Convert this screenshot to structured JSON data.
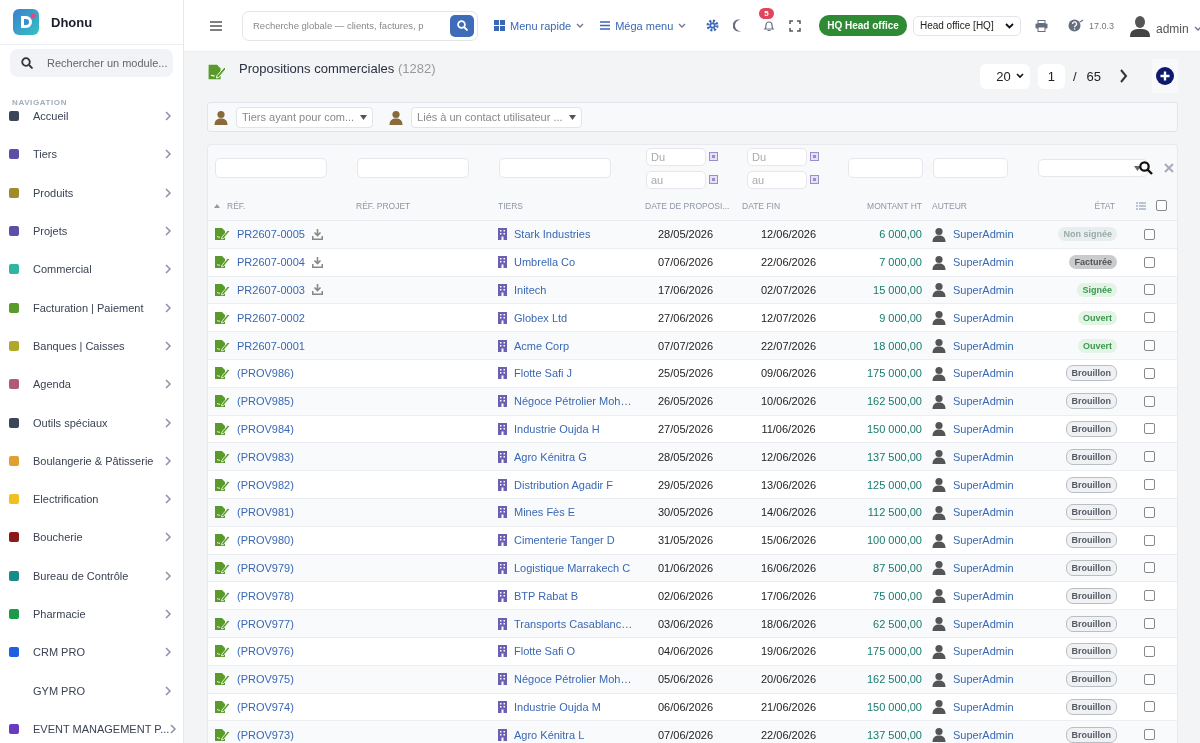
{
  "brand": {
    "name": "Dhonu"
  },
  "sidebar": {
    "search_placeholder": "Rechercher un module...",
    "section": "NAVIGATION",
    "items": [
      {
        "label": "Accueil",
        "color": "#3d4657"
      },
      {
        "label": "Tiers",
        "color": "#5b4fa8"
      },
      {
        "label": "Produits",
        "color": "#a08a2a"
      },
      {
        "label": "Projets",
        "color": "#5b4fa8"
      },
      {
        "label": "Commercial",
        "color": "#2fb5a0"
      },
      {
        "label": "Facturation | Paiement",
        "color": "#5a9a2a"
      },
      {
        "label": "Banques | Caisses",
        "color": "#b0a82a"
      },
      {
        "label": "Agenda",
        "color": "#b05a7a"
      },
      {
        "label": "Outils spéciaux",
        "color": "#3d4657"
      },
      {
        "label": "Boulangerie & Pâtisserie",
        "color": "#e0a030"
      },
      {
        "label": "Electrification",
        "color": "#f0c020"
      },
      {
        "label": "Boucherie",
        "color": "#8a1a1a"
      },
      {
        "label": "Bureau de Contrôle",
        "color": "#1a8a8a"
      },
      {
        "label": "Pharmacie",
        "color": "#1a9a4a"
      },
      {
        "label": "CRM PRO",
        "color": "#2060e0"
      },
      {
        "label": "GYM PRO"
      },
      {
        "label": "EVENT MANAGEMENT P...",
        "color": "#6a3ac0"
      }
    ]
  },
  "topbar": {
    "search_placeholder": "Recherche globale — clients, factures, p",
    "quick_menu": "Menu rapide",
    "mega_menu": "Méga menu",
    "notifications": "5",
    "entity_badge": "HQ Head office",
    "entity_select": "Head office [HQ]",
    "version": "17.0.3",
    "user": "admin"
  },
  "page": {
    "title": "Propositions commerciales",
    "count": "(1282)",
    "per_page": "20",
    "page": "1",
    "separator": "/",
    "pages": "65"
  },
  "filters": [
    {
      "placeholder": "Tiers ayant pour com..."
    },
    {
      "placeholder": "Liés à un contact utilisateur ..."
    }
  ],
  "table": {
    "date_filters": [
      {
        "from": "Du",
        "to": "au"
      },
      {
        "from": "Du",
        "to": "au"
      }
    ],
    "columns": [
      "RÉF.",
      "RÉF. PROJET",
      "TIERS",
      "DATE DE PROPOSI...",
      "DATE FIN",
      "MONTANT HT",
      "AUTEUR",
      "ÉTAT"
    ],
    "select_all": false,
    "rows": [
      {
        "ref": "PR2607-0005",
        "download": true,
        "tiers": "Stark Industries",
        "date": "28/05/2026",
        "end": "12/06/2026",
        "amount": "6 000,00",
        "author": "SuperAdmin",
        "status": {
          "label": "Non signée",
          "kind": "unsigned"
        },
        "checked": false
      },
      {
        "ref": "PR2607-0004",
        "download": true,
        "tiers": "Umbrella Co",
        "date": "07/06/2026",
        "end": "22/06/2026",
        "amount": "7 000,00",
        "author": "SuperAdmin",
        "status": {
          "label": "Facturée",
          "kind": "billed"
        },
        "checked": false
      },
      {
        "ref": "PR2607-0003",
        "download": true,
        "tiers": "Initech",
        "date": "17/06/2026",
        "end": "02/07/2026",
        "amount": "15 000,00",
        "author": "SuperAdmin",
        "status": {
          "label": "Signée",
          "kind": "signed"
        },
        "checked": false
      },
      {
        "ref": "PR2607-0002",
        "download": false,
        "tiers": "Globex Ltd",
        "date": "27/06/2026",
        "end": "12/07/2026",
        "amount": "9 000,00",
        "author": "SuperAdmin",
        "status": {
          "label": "Ouvert",
          "kind": "open"
        },
        "checked": false
      },
      {
        "ref": "PR2607-0001",
        "download": false,
        "tiers": "Acme Corp",
        "date": "07/07/2026",
        "end": "22/07/2026",
        "amount": "18 000,00",
        "author": "SuperAdmin",
        "status": {
          "label": "Ouvert",
          "kind": "open"
        },
        "checked": false
      },
      {
        "ref": "(PROV986)",
        "download": false,
        "tiers": "Flotte Safi J",
        "date": "25/05/2026",
        "end": "09/06/2026",
        "amount": "175 000,00",
        "author": "SuperAdmin",
        "status": {
          "label": "Brouillon",
          "kind": "draft"
        },
        "checked": false
      },
      {
        "ref": "(PROV985)",
        "download": false,
        "tiers": "Négoce Pétrolier Moh…",
        "date": "26/05/2026",
        "end": "10/06/2026",
        "amount": "162 500,00",
        "author": "SuperAdmin",
        "status": {
          "label": "Brouillon",
          "kind": "draft"
        },
        "checked": false
      },
      {
        "ref": "(PROV984)",
        "download": false,
        "tiers": "Industrie Oujda H",
        "date": "27/05/2026",
        "end": "11/06/2026",
        "amount": "150 000,00",
        "author": "SuperAdmin",
        "status": {
          "label": "Brouillon",
          "kind": "draft"
        },
        "checked": false
      },
      {
        "ref": "(PROV983)",
        "download": false,
        "tiers": "Agro Kénitra G",
        "date": "28/05/2026",
        "end": "12/06/2026",
        "amount": "137 500,00",
        "author": "SuperAdmin",
        "status": {
          "label": "Brouillon",
          "kind": "draft"
        },
        "checked": false
      },
      {
        "ref": "(PROV982)",
        "download": false,
        "tiers": "Distribution Agadir F",
        "date": "29/05/2026",
        "end": "13/06/2026",
        "amount": "125 000,00",
        "author": "SuperAdmin",
        "status": {
          "label": "Brouillon",
          "kind": "draft"
        },
        "checked": false
      },
      {
        "ref": "(PROV981)",
        "download": false,
        "tiers": "Mines Fès E",
        "date": "30/05/2026",
        "end": "14/06/2026",
        "amount": "112 500,00",
        "author": "SuperAdmin",
        "status": {
          "label": "Brouillon",
          "kind": "draft"
        },
        "checked": false
      },
      {
        "ref": "(PROV980)",
        "download": false,
        "tiers": "Cimenterie Tanger D",
        "date": "31/05/2026",
        "end": "15/06/2026",
        "amount": "100 000,00",
        "author": "SuperAdmin",
        "status": {
          "label": "Brouillon",
          "kind": "draft"
        },
        "checked": false
      },
      {
        "ref": "(PROV979)",
        "download": false,
        "tiers": "Logistique Marrakech C",
        "date": "01/06/2026",
        "end": "16/06/2026",
        "amount": "87 500,00",
        "author": "SuperAdmin",
        "status": {
          "label": "Brouillon",
          "kind": "draft"
        },
        "checked": false
      },
      {
        "ref": "(PROV978)",
        "download": false,
        "tiers": "BTP Rabat B",
        "date": "02/06/2026",
        "end": "17/06/2026",
        "amount": "75 000,00",
        "author": "SuperAdmin",
        "status": {
          "label": "Brouillon",
          "kind": "draft"
        },
        "checked": false
      },
      {
        "ref": "(PROV977)",
        "download": false,
        "tiers": "Transports Casablanc…",
        "date": "03/06/2026",
        "end": "18/06/2026",
        "amount": "62 500,00",
        "author": "SuperAdmin",
        "status": {
          "label": "Brouillon",
          "kind": "draft"
        },
        "checked": false
      },
      {
        "ref": "(PROV976)",
        "download": false,
        "tiers": "Flotte Safi O",
        "date": "04/06/2026",
        "end": "19/06/2026",
        "amount": "175 000,00",
        "author": "SuperAdmin",
        "status": {
          "label": "Brouillon",
          "kind": "draft"
        },
        "checked": false
      },
      {
        "ref": "(PROV975)",
        "download": false,
        "tiers": "Négoce Pétrolier Moh…",
        "date": "05/06/2026",
        "end": "20/06/2026",
        "amount": "162 500,00",
        "author": "SuperAdmin",
        "status": {
          "label": "Brouillon",
          "kind": "draft"
        },
        "checked": false
      },
      {
        "ref": "(PROV974)",
        "download": false,
        "tiers": "Industrie Oujda M",
        "date": "06/06/2026",
        "end": "21/06/2026",
        "amount": "150 000,00",
        "author": "SuperAdmin",
        "status": {
          "label": "Brouillon",
          "kind": "draft"
        },
        "checked": false
      },
      {
        "ref": "(PROV973)",
        "download": false,
        "tiers": "Agro Kénitra L",
        "date": "07/06/2026",
        "end": "22/06/2026",
        "amount": "137 500,00",
        "author": "SuperAdmin",
        "status": {
          "label": "Brouillon",
          "kind": "draft"
        },
        "checked": false
      }
    ]
  }
}
